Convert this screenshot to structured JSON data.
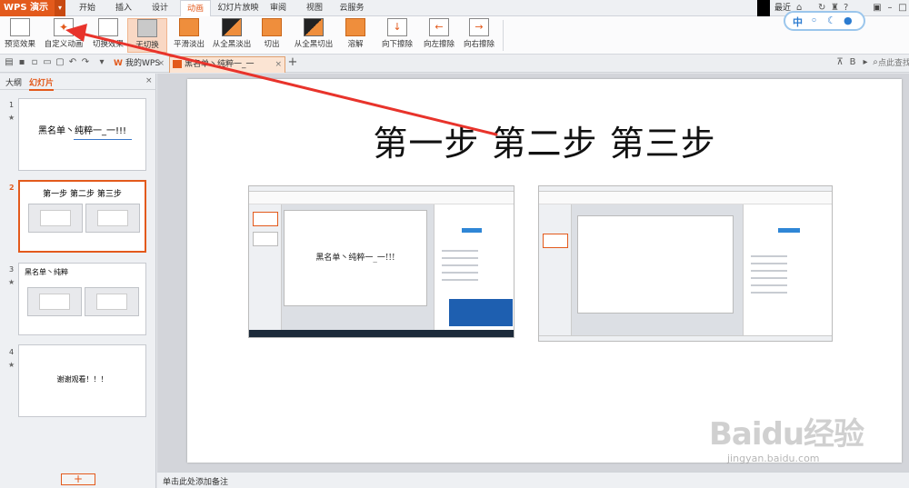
{
  "app": {
    "name": "WPS 演示",
    "dropdown_glyph": "▾"
  },
  "menu": {
    "tabs": [
      "开始",
      "插入",
      "设计",
      "动画",
      "幻灯片放映",
      "审阅",
      "视图",
      "云服务"
    ],
    "active_tab": "动画",
    "recent_label": "最近"
  },
  "ribbon": {
    "buttons": [
      "预览效果",
      "自定义动画",
      "切换效果",
      "无切换",
      "平滑淡出",
      "从全黑淡出",
      "切出",
      "从全黑切出",
      "溶解",
      "向下擦除",
      "向左擦除",
      "向右擦除"
    ],
    "selected": "无切换"
  },
  "ime": {
    "mode": "中"
  },
  "quickbar": {
    "doc_tabs": [
      {
        "label": "我的WPS",
        "close": "×"
      },
      {
        "label": "黑名单丶纯粹一_一",
        "close": "×"
      }
    ],
    "add_tab": "+",
    "search_placeholder": "点此查找"
  },
  "left_panel": {
    "tabs": [
      "大纲",
      "幻灯片"
    ],
    "active_tab": "幻灯片",
    "close": "×",
    "slides": [
      {
        "num": "1",
        "title": "黑名单丶纯粹一_一!!!",
        "animated": true
      },
      {
        "num": "2",
        "title": "第一步  第二步  第三步",
        "animated": false
      },
      {
        "num": "3",
        "title": "黑名单丶纯粹",
        "animated": true
      },
      {
        "num": "4",
        "title": "谢谢观看！！！",
        "animated": true
      }
    ],
    "active_slide": "2",
    "add_button": "+"
  },
  "slide": {
    "title": "第一步  第二步  第三步",
    "embedded_text": "黑名单丶纯粹一_一!!!"
  },
  "status": {
    "note_placeholder": "单击此处添加备注"
  },
  "watermark": {
    "brand": "Baidu经验",
    "url": "jingyan.baidu.com"
  },
  "colors": {
    "accent": "#e35a1c",
    "annotation_arrow": "#e8332b",
    "ribbon_selected": "#f9d8c4"
  }
}
